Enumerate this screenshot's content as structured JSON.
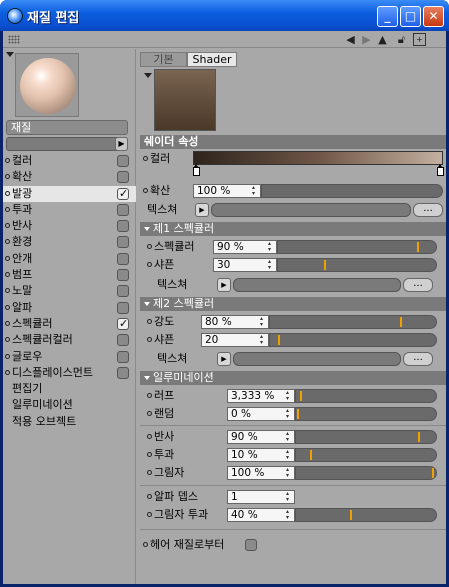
{
  "window": {
    "title": "재질 편집"
  },
  "left": {
    "material_name": "재질",
    "channels": [
      {
        "label": "컬러",
        "checked": false,
        "dot": true
      },
      {
        "label": "확산",
        "checked": false,
        "dot": true
      },
      {
        "label": "발광",
        "checked": true,
        "dot": true,
        "selected": true
      },
      {
        "label": "투과",
        "checked": false,
        "dot": true
      },
      {
        "label": "반사",
        "checked": false,
        "dot": true
      },
      {
        "label": "환경",
        "checked": false,
        "dot": true
      },
      {
        "label": "안개",
        "checked": false,
        "dot": true
      },
      {
        "label": "범프",
        "checked": false,
        "dot": true
      },
      {
        "label": "노말",
        "checked": false,
        "dot": true
      },
      {
        "label": "알파",
        "checked": false,
        "dot": true
      },
      {
        "label": "스펙큘러",
        "checked": true,
        "dot": true
      },
      {
        "label": "스펙큘러컬러",
        "checked": false,
        "dot": true
      },
      {
        "label": "글로우",
        "checked": false,
        "dot": true
      },
      {
        "label": "디스플레이스먼트",
        "checked": false,
        "dot": true
      }
    ],
    "extra_items": [
      "편집기",
      "일루미네이션",
      "적용 오브젝트"
    ]
  },
  "right": {
    "tabs": [
      "기본",
      "Shader"
    ],
    "props_header": "쉐이더 속성",
    "color_label": "컬러",
    "diffuse": {
      "label": "확산",
      "value": "100 %"
    },
    "texture_label": "텍스쳐",
    "dots": "...",
    "spec1": {
      "title": "제1 스펙큘러",
      "color": {
        "label": "스펙큘러",
        "value": "90 %",
        "level": 0.9
      },
      "sharp": {
        "label": "샤픈",
        "value": "30",
        "level": 0.3
      }
    },
    "spec2": {
      "title": "제2 스펙큘러",
      "strength": {
        "label": "강도",
        "value": "80 %",
        "level": 0.8
      },
      "sharp": {
        "label": "샤픈",
        "value": "20",
        "level": 0.05
      }
    },
    "illum": {
      "title": "일루미네이션",
      "rough": {
        "label": "러프",
        "value": "3,333 %",
        "level": 0.03
      },
      "random": {
        "label": "랜덤",
        "value": "0 %",
        "level": 0.0
      },
      "reflect": {
        "label": "반사",
        "value": "90 %",
        "level": 0.9
      },
      "trans": {
        "label": "투과",
        "value": "10 %",
        "level": 0.1
      },
      "shadow": {
        "label": "그림자",
        "value": "100 %",
        "level": 1.0
      },
      "alpha_depth": {
        "label": "알파 뎁스",
        "value": "1"
      },
      "shadow_trans": {
        "label": "그림자 투과",
        "value": "40 %",
        "level": 0.4
      }
    },
    "hair": "헤어 재질로부터"
  },
  "colors": {
    "titlebar": "#0a4fd0",
    "panel": "#a8a8a8",
    "knob": "#f0a000"
  }
}
